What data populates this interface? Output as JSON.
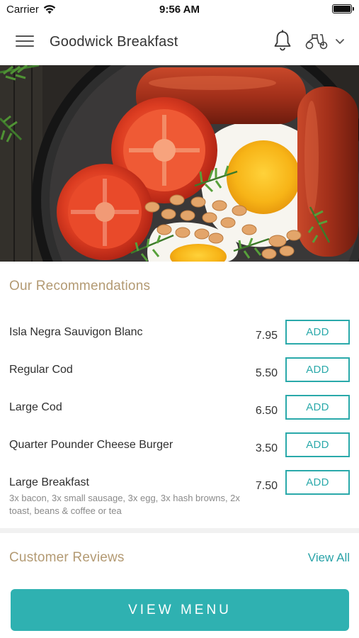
{
  "status_bar": {
    "carrier": "Carrier",
    "time": "9:56 AM"
  },
  "header": {
    "title": "Goodwick Breakfast",
    "icons": [
      "menu-icon",
      "bell-icon",
      "scooter-icon",
      "chevron-down-icon"
    ]
  },
  "hero": {
    "image_subject": "full breakfast"
  },
  "recommendations": {
    "title": "Our Recommendations",
    "add_label": "ADD",
    "items": [
      {
        "name": "Isla Negra Sauvigon Blanc",
        "price": "7.95",
        "description": ""
      },
      {
        "name": "Regular Cod",
        "price": "5.50",
        "description": ""
      },
      {
        "name": "Large Cod",
        "price": "6.50",
        "description": ""
      },
      {
        "name": "Quarter Pounder Cheese Burger",
        "price": "3.50",
        "description": ""
      },
      {
        "name": "Large Breakfast",
        "price": "7.50",
        "description": "3x bacon, 3x small sausage, 3x egg, 3x hash browns, 2x toast, beans & coffee or tea"
      }
    ]
  },
  "reviews": {
    "title": "Customer Reviews",
    "view_all": "View All"
  },
  "footer": {
    "view_menu": "VIEW MENU"
  },
  "colors": {
    "accent": "#2fb1b1",
    "section_title": "#b39a73",
    "text": "#2f2f2f"
  }
}
